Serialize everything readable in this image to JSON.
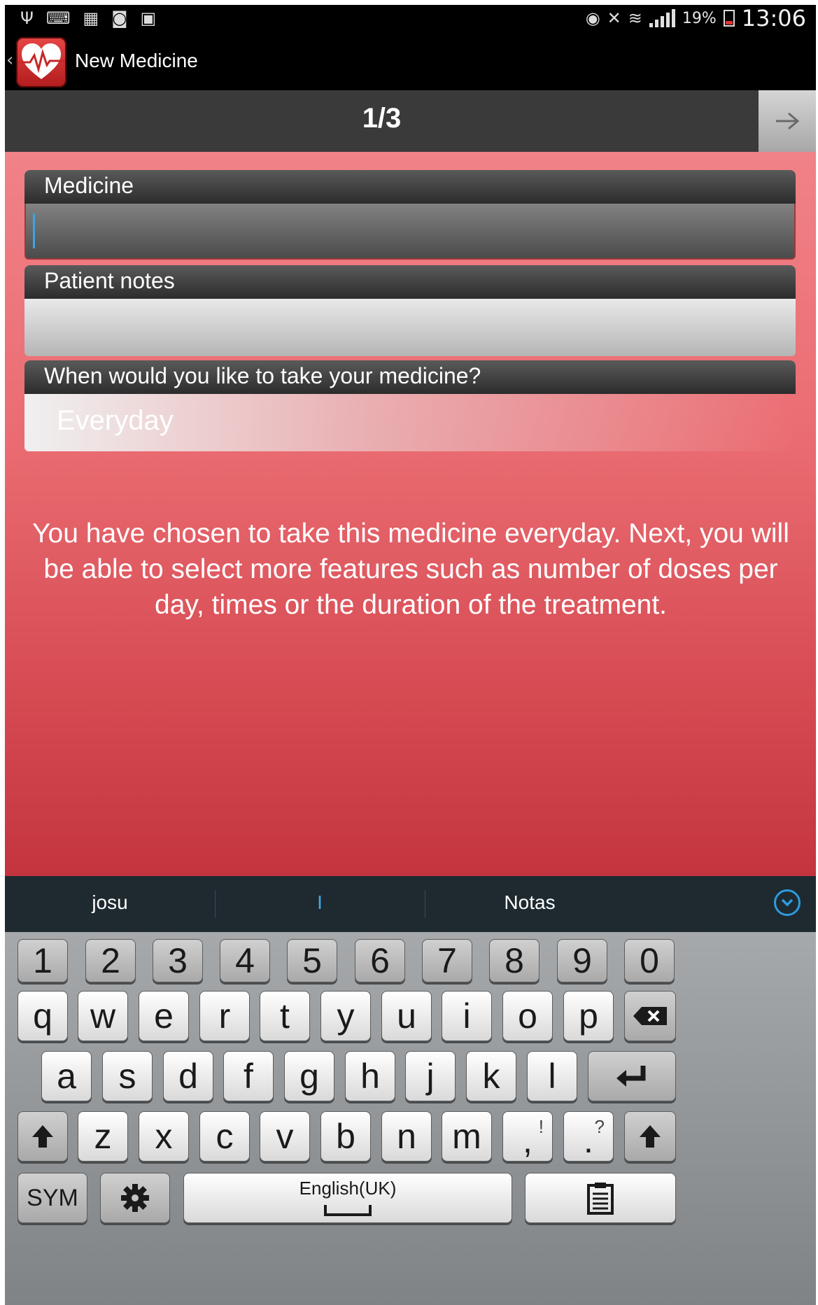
{
  "status_bar": {
    "battery_percent": "19%",
    "time": "13:06",
    "icons": [
      "usb-icon",
      "keyboard-icon",
      "sim-icon",
      "screenshot-icon",
      "gallery-icon",
      "eye-icon",
      "mute-icon",
      "wifi-icon",
      "signal-icon",
      "battery-icon"
    ]
  },
  "action_bar": {
    "title": "New Medicine",
    "back_glyph": "‹"
  },
  "step_bar": {
    "title": "1/3",
    "next_icon": "arrow-right-icon"
  },
  "form": {
    "medicine_label": "Medicine",
    "medicine_value": "",
    "notes_label": "Patient notes",
    "notes_value": "",
    "schedule_label": "When would you like to take your medicine?",
    "schedule_value": "Everyday",
    "info": "You have chosen to take this medicine everyday. Next, you will be able to select more features such as number of doses per day, times or the duration of the treatment."
  },
  "suggestions": {
    "left": "josu",
    "middle": "I",
    "right": "Notas"
  },
  "keyboard": {
    "number_row": [
      "1",
      "2",
      "3",
      "4",
      "5",
      "6",
      "7",
      "8",
      "9",
      "0"
    ],
    "row1": [
      "q",
      "w",
      "e",
      "r",
      "t",
      "y",
      "u",
      "i",
      "o",
      "p"
    ],
    "row2": [
      "a",
      "s",
      "d",
      "f",
      "g",
      "h",
      "j",
      "k",
      "l"
    ],
    "row3": [
      "z",
      "x",
      "c",
      "v",
      "b",
      "n",
      "m"
    ],
    "comma_key": {
      "main": ",",
      "sub": "!"
    },
    "period_key": {
      "main": ".",
      "sub": "?"
    },
    "sym_label": "SYM",
    "space_label": "English(UK)",
    "icons": [
      "backspace-icon",
      "enter-icon",
      "shift-icon",
      "settings-icon",
      "clipboard-icon"
    ]
  },
  "colors": {
    "accent_blue": "#3aa4e8",
    "content_top": "#f08288",
    "content_bottom": "#c3343f"
  }
}
